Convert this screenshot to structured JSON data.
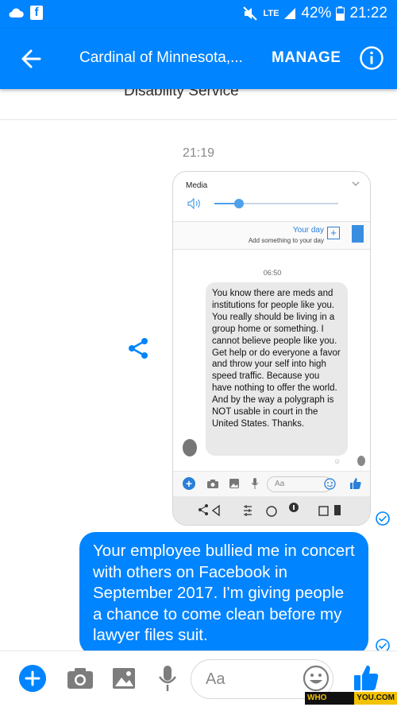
{
  "status_bar": {
    "network": "LTE",
    "battery": "42%",
    "time": "21:22"
  },
  "header": {
    "title": "Cardinal of Minnesota,...",
    "manage_label": "MANAGE"
  },
  "conversation": {
    "previous_text": "Disability Service",
    "timestamp": "21:19",
    "shared_screenshot": {
      "media_label": "Media",
      "media_volume_percent": 20,
      "your_day_title": "Your day",
      "your_day_subtitle": "Add something to your day",
      "time": "06:50",
      "message": "You know there are meds and institutions for people like you.  You really should be living in a group home or something.  I cannot believe people like you.  Get help or do everyone a favor and throw your self into high speed traffic.  Because you have nothing to offer the world.  And by the way a polygraph is NOT usable in court in the United States. Thanks.",
      "composer_placeholder": "Aa"
    },
    "outgoing_message": "Your employee bullied me in concert with others on Facebook in September 2017. I'm giving people a chance to come clean before my lawyer files suit."
  },
  "composer": {
    "placeholder": "Aa"
  },
  "watermark": {
    "part1": "WHO SCAMMED",
    "part2": "YOU.COM"
  },
  "colors": {
    "brand": "#0084ff",
    "bubble_incoming": "#e9e9e9"
  },
  "icons": [
    "cloud-icon",
    "facebook-icon",
    "mute-icon",
    "signal-icon",
    "battery-icon",
    "back-arrow-icon",
    "info-icon",
    "share-icon",
    "check-circle-icon",
    "plus-icon",
    "camera-icon",
    "image-icon",
    "mic-icon",
    "emoji-icon",
    "thumbs-up-icon"
  ]
}
